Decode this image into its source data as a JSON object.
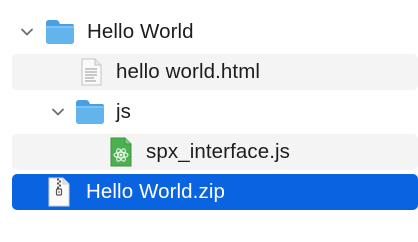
{
  "rows": [
    {
      "name": "Hello World",
      "kind": "folder",
      "icon": "folder-icon",
      "expanded": true
    },
    {
      "name": "hello world.html",
      "kind": "file",
      "icon": "html-document-icon"
    },
    {
      "name": "js",
      "kind": "folder",
      "icon": "folder-icon",
      "expanded": true
    },
    {
      "name": "spx_interface.js",
      "kind": "file",
      "icon": "javascript-document-icon"
    },
    {
      "name": "Hello World.zip",
      "kind": "archive",
      "icon": "zip-archive-icon",
      "selected": true
    }
  ],
  "colors": {
    "selection": "#0a63e0",
    "alternate_row": "#f4f4f4",
    "folder_blue": "#5aaee8",
    "js_green": "#4caf50"
  }
}
